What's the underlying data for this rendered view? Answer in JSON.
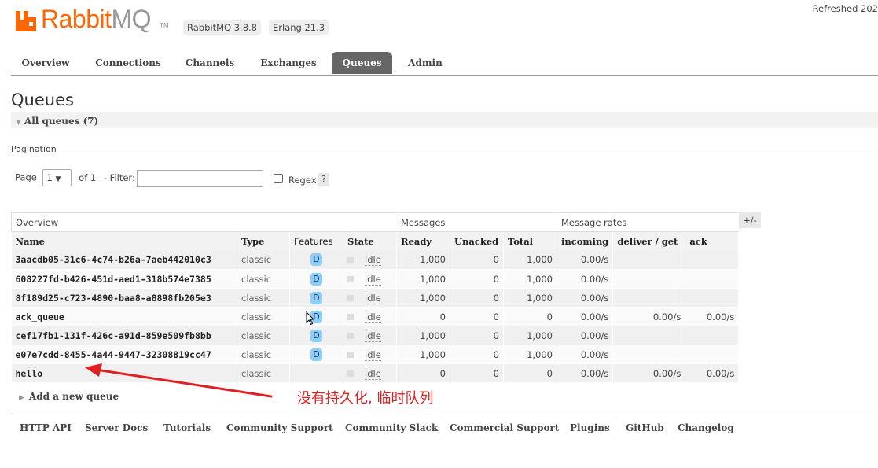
{
  "header": {
    "logo_brand": "Rabbit",
    "logo_mq": "MQ",
    "logo_tm": "TM",
    "version_rabbitmq": "RabbitMQ 3.8.8",
    "version_erlang": "Erlang 21.3",
    "refreshed": "Refreshed 202"
  },
  "nav": {
    "overview": "Overview",
    "connections": "Connections",
    "channels": "Channels",
    "exchanges": "Exchanges",
    "queues": "Queues",
    "admin": "Admin",
    "active_tab": "Queues"
  },
  "main": {
    "title": "Queues",
    "all_queues_label": "All queues (7)",
    "pagination_label": "Pagination",
    "page_label": "Page",
    "page_value": "1",
    "of_label": "of 1",
    "filter_label": "- Filter:",
    "filter_value": "",
    "regex_label": "Regex",
    "help_label": "?",
    "add_queue_label": "Add a new queue",
    "annotation": "没有持久化, 临时队列"
  },
  "table": {
    "groups": {
      "overview": "Overview",
      "messages": "Messages",
      "rates": "Message rates"
    },
    "columns": {
      "name": "Name",
      "type": "Type",
      "features": "Features",
      "state": "State",
      "ready": "Ready",
      "unacked": "Unacked",
      "total": "Total",
      "incoming": "incoming",
      "deliver_get": "deliver / get",
      "ack": "ack"
    },
    "plus_minus": "+/-",
    "rows": [
      {
        "name": "3aacdb05-31c6-4c74-b26a-7aeb442010c3",
        "type": "classic",
        "features": "D",
        "state": "idle",
        "ready": "1,000",
        "unacked": "0",
        "total": "1,000",
        "incoming": "0.00/s",
        "deliver_get": "",
        "ack": ""
      },
      {
        "name": "608227fd-b426-451d-aed1-318b574e7385",
        "type": "classic",
        "features": "D",
        "state": "idle",
        "ready": "1,000",
        "unacked": "0",
        "total": "1,000",
        "incoming": "0.00/s",
        "deliver_get": "",
        "ack": ""
      },
      {
        "name": "8f189d25-c723-4890-baa8-a8898fb205e3",
        "type": "classic",
        "features": "D",
        "state": "idle",
        "ready": "1,000",
        "unacked": "0",
        "total": "1,000",
        "incoming": "0.00/s",
        "deliver_get": "",
        "ack": ""
      },
      {
        "name": "ack_queue",
        "type": "classic",
        "features": "D",
        "state": "idle",
        "ready": "0",
        "unacked": "0",
        "total": "0",
        "incoming": "0.00/s",
        "deliver_get": "0.00/s",
        "ack": "0.00/s"
      },
      {
        "name": "cef17fb1-131f-426c-a91d-859e509fb8bb",
        "type": "classic",
        "features": "D",
        "state": "idle",
        "ready": "1,000",
        "unacked": "0",
        "total": "1,000",
        "incoming": "0.00/s",
        "deliver_get": "",
        "ack": ""
      },
      {
        "name": "e07e7cdd-8455-4a44-9447-32308819cc47",
        "type": "classic",
        "features": "D",
        "state": "idle",
        "ready": "1,000",
        "unacked": "0",
        "total": "1,000",
        "incoming": "0.00/s",
        "deliver_get": "",
        "ack": ""
      },
      {
        "name": "hello",
        "type": "classic",
        "features": "",
        "state": "idle",
        "ready": "0",
        "unacked": "0",
        "total": "0",
        "incoming": "0.00/s",
        "deliver_get": "0.00/s",
        "ack": "0.00/s"
      }
    ]
  },
  "footer": {
    "http_api": "HTTP API",
    "server_docs": "Server Docs",
    "tutorials": "Tutorials",
    "community_support": "Community Support",
    "community_slack": "Community Slack",
    "commercial_support": "Commercial Support",
    "plugins": "Plugins",
    "github": "GitHub",
    "changelog": "Changelog"
  },
  "colors": {
    "brand_orange": "#ff6600",
    "active_tab": "#666666",
    "feature_badge": "#8ccffa",
    "annotation_red": "#e02020"
  },
  "icons": [
    "rabbitmq-logo-icon",
    "collapse-triangle-icon",
    "expand-triangle-icon",
    "dropdown-chevron-icon",
    "mouse-cursor-icon",
    "annotation-arrow-icon"
  ]
}
